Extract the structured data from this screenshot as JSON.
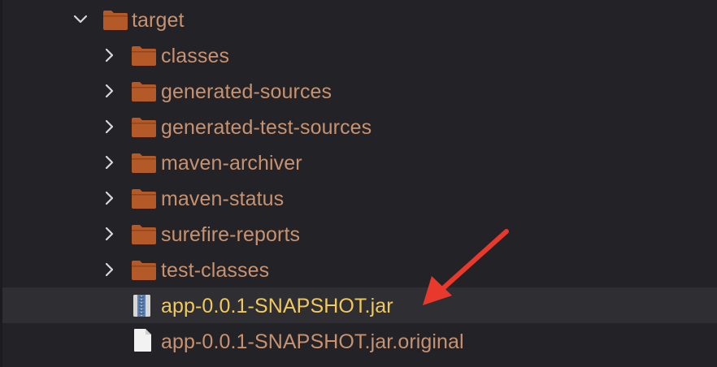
{
  "tree": {
    "root": {
      "label": "target",
      "expanded": true
    },
    "folders": [
      {
        "label": "classes"
      },
      {
        "label": "generated-sources"
      },
      {
        "label": "generated-test-sources"
      },
      {
        "label": "maven-archiver"
      },
      {
        "label": "maven-status"
      },
      {
        "label": "surefire-reports"
      },
      {
        "label": "test-classes"
      }
    ],
    "files": [
      {
        "label": "app-0.0.1-SNAPSHOT.jar",
        "icon": "jar-archive-icon",
        "selected": true
      },
      {
        "label": "app-0.0.1-SNAPSHOT.jar.original",
        "icon": "file-icon",
        "selected": false
      }
    ]
  },
  "colors": {
    "background": "#232226",
    "selected_row": "#2f2e33",
    "folder": "#b35a28",
    "folder_label": "#c79270",
    "jar_label": "#f0c95c",
    "chevron": "#d8d8d8",
    "annotation_arrow": "#e8392c"
  }
}
